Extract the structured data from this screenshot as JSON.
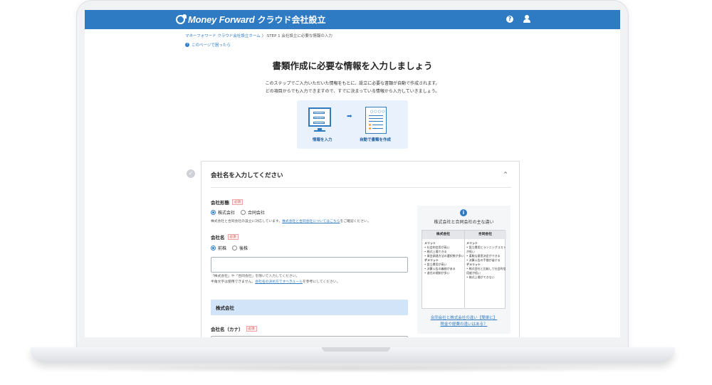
{
  "header": {
    "brand_name": "Money Forward",
    "brand_sub": "クラウド会社設立",
    "help_icon": "?",
    "icons": [
      "logo-icon",
      "help-icon",
      "user-icon"
    ]
  },
  "breadcrumb": {
    "home": "マネーフォワード クラウド会社設立ホーム",
    "separator": "〉",
    "current": "STEP 1 会社設立に必要な情報の入力"
  },
  "about_link": "このページで困ったら",
  "page_title": "書類作成に必要な情報を入力しましょう",
  "lead": {
    "line1": "このステップでご入力いただいた情報をもとに、設立に必要な書類が自動で作成されます。",
    "line2": "どの項目からでも入力できますので、すでに決まっている情報から入力していきましょう。"
  },
  "illustration": {
    "label_input": "情報を入力",
    "label_auto": "自動で書類を作成",
    "arrow": "➡",
    "doc_dots": "○○○○"
  },
  "section": {
    "check": "✓",
    "title": "会社名を入力してください",
    "chevron": "^"
  },
  "form": {
    "company_type": {
      "label": "会社形態",
      "required": "必須",
      "options": [
        "株式会社",
        "合同会社"
      ],
      "selected": "株式会社",
      "hint_prefix": "株式会社と合同会社の設立に対応しています。",
      "hint_link": "株式会社と合同会社についてはこちら",
      "hint_suffix": "をご確認ください。"
    },
    "company_name": {
      "label": "会社名",
      "required": "必須",
      "options": [
        "前株",
        "後株"
      ],
      "selected": "前株",
      "value": "",
      "hint_line1": "「株式会社」や「合同会社」を除いて入力してください。",
      "hint_line2_prefix": "半角文字は使用できません。",
      "hint_link": "会社名の決め方ですべきルール",
      "hint_line2_suffix": "を参考にしてください。",
      "preview": "株式会社"
    },
    "company_name_kana": {
      "label": "会社名（カナ）",
      "required": "必須",
      "value": ""
    }
  },
  "sidebar": {
    "info_icon": "i",
    "title": "株式会社と合同会社の主な違い",
    "columns": [
      {
        "header": "株式会社",
        "merit_label": "メリット",
        "merits": [
          "社会的信用が高い",
          "株式上場できる",
          "資金調達方法の選択肢が多い"
        ],
        "demerit_label": "デメリット",
        "demerits": [
          "設立費用が高い",
          "決算公告の義務がある",
          "退任の規制が多い"
        ]
      },
      {
        "header": "合同会社",
        "merit_label": "メリット",
        "merits": [
          "設立費用とランニングコストが低い",
          "柔軟な意思決定ができる",
          "決算公告の手間が省ける"
        ],
        "demerit_label": "デメリット",
        "demerits": [
          "株式会社と比較して社会的信用度が低い",
          "株式上場ができない"
        ]
      }
    ],
    "link_line1": "合同会社と株式会社の違い【簡単に】",
    "link_line2": "税金や経費の違いはある？"
  }
}
